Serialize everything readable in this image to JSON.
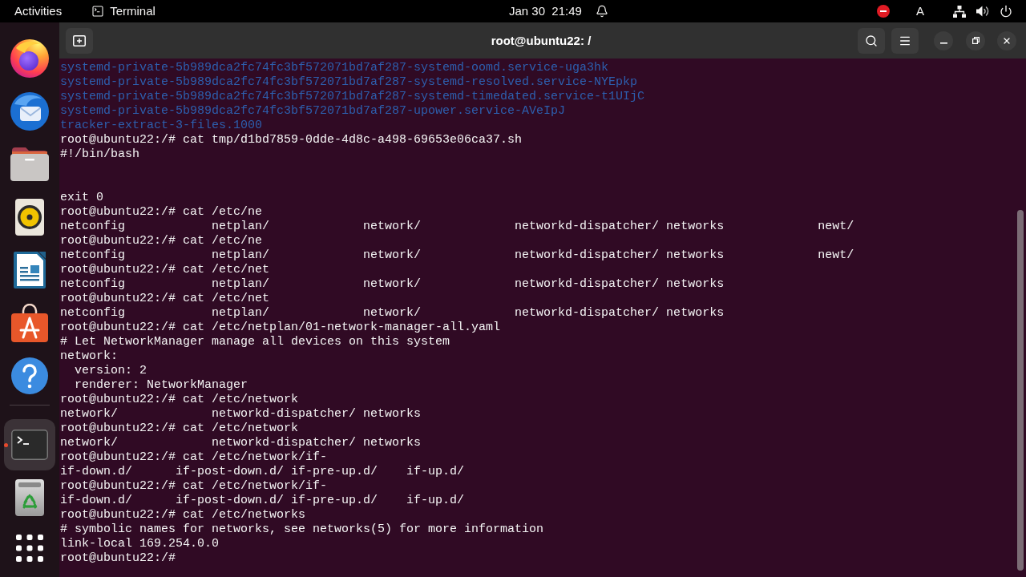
{
  "top_bar": {
    "activities": "Activities",
    "app_menu": "Terminal",
    "clock": "Jan 30  21:49",
    "input_source": "A"
  },
  "dock": {
    "favorites": [
      {
        "kind": "browser",
        "active": false
      },
      {
        "kind": "mail",
        "active": false
      },
      {
        "kind": "files",
        "active": false
      },
      {
        "kind": "music",
        "active": false
      },
      {
        "kind": "writer",
        "active": false
      },
      {
        "kind": "store",
        "active": false
      },
      {
        "kind": "help",
        "active": false
      }
    ],
    "others": [
      {
        "kind": "terminal",
        "active": true
      },
      {
        "kind": "trash",
        "active": false
      }
    ]
  },
  "window": {
    "title": "root@ubuntu22: /"
  },
  "terminal": {
    "lines": [
      {
        "kind": "dir",
        "text": "systemd-private-5b989dca2fc74fc3bf572071bd7af287-systemd-oomd.service-uga3hk"
      },
      {
        "kind": "dir",
        "text": "systemd-private-5b989dca2fc74fc3bf572071bd7af287-systemd-resolved.service-NYEpkp"
      },
      {
        "kind": "dir",
        "text": "systemd-private-5b989dca2fc74fc3bf572071bd7af287-systemd-timedated.service-t1UIjC"
      },
      {
        "kind": "dir",
        "text": "systemd-private-5b989dca2fc74fc3bf572071bd7af287-upower.service-AVeIpJ"
      },
      {
        "kind": "dir",
        "text": "tracker-extract-3-files.1000"
      },
      {
        "kind": "text",
        "text": "root@ubuntu22:/# cat tmp/d1bd7859-0dde-4d8c-a498-69653e06ca37.sh"
      },
      {
        "kind": "text",
        "text": "#!/bin/bash"
      },
      {
        "kind": "blank"
      },
      {
        "kind": "blank"
      },
      {
        "kind": "text",
        "text": "exit 0"
      },
      {
        "kind": "text",
        "text": "root@ubuntu22:/# cat /etc/ne"
      },
      {
        "kind": "text",
        "text": "netconfig            netplan/             network/             networkd-dispatcher/ networks             newt/"
      },
      {
        "kind": "text",
        "text": "root@ubuntu22:/# cat /etc/ne"
      },
      {
        "kind": "text",
        "text": "netconfig            netplan/             network/             networkd-dispatcher/ networks             newt/"
      },
      {
        "kind": "text",
        "text": "root@ubuntu22:/# cat /etc/net"
      },
      {
        "kind": "text",
        "text": "netconfig            netplan/             network/             networkd-dispatcher/ networks"
      },
      {
        "kind": "text",
        "text": "root@ubuntu22:/# cat /etc/net"
      },
      {
        "kind": "text",
        "text": "netconfig            netplan/             network/             networkd-dispatcher/ networks"
      },
      {
        "kind": "text",
        "text": "root@ubuntu22:/# cat /etc/netplan/01-network-manager-all.yaml"
      },
      {
        "kind": "text",
        "text": "# Let NetworkManager manage all devices on this system"
      },
      {
        "kind": "text",
        "text": "network:"
      },
      {
        "kind": "text",
        "text": "  version: 2"
      },
      {
        "kind": "text",
        "text": "  renderer: NetworkManager"
      },
      {
        "kind": "text",
        "text": "root@ubuntu22:/# cat /etc/network"
      },
      {
        "kind": "text",
        "text": "network/             networkd-dispatcher/ networks"
      },
      {
        "kind": "text",
        "text": "root@ubuntu22:/# cat /etc/network"
      },
      {
        "kind": "text",
        "text": "network/             networkd-dispatcher/ networks"
      },
      {
        "kind": "text",
        "text": "root@ubuntu22:/# cat /etc/network/if-"
      },
      {
        "kind": "text",
        "text": "if-down.d/      if-post-down.d/ if-pre-up.d/    if-up.d/"
      },
      {
        "kind": "text",
        "text": "root@ubuntu22:/# cat /etc/network/if-"
      },
      {
        "kind": "text",
        "text": "if-down.d/      if-post-down.d/ if-pre-up.d/    if-up.d/"
      },
      {
        "kind": "text",
        "text": "root@ubuntu22:/# cat /etc/networks"
      },
      {
        "kind": "text",
        "text": "# symbolic names for networks, see networks(5) for more information"
      },
      {
        "kind": "text",
        "text": "link-local 169.254.0.0"
      },
      {
        "kind": "text",
        "text": "root@ubuntu22:/#"
      }
    ]
  }
}
